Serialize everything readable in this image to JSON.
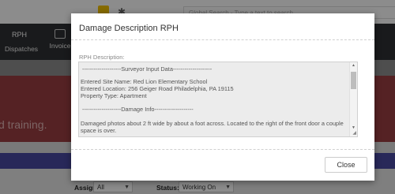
{
  "header": {
    "search_placeholder": "Global Search - Type a text to search"
  },
  "nav": {
    "rph_label": "RPH",
    "dispatches_label": "Dispatches",
    "invoices_label": "Invoice"
  },
  "banner": {
    "text": "d training."
  },
  "filters": {
    "assigned_label": "Assigned To:",
    "assigned_value": "All",
    "status_label": "Status:",
    "status_value": "Working On"
  },
  "modal": {
    "title": "Damage Description RPH",
    "field_label": "RPH Description:",
    "lines": [
      "--------------------Surveyor Input Data--------------------",
      "Entered Site Name: Red Lion Elementary School",
      "Entered Location: 256 Geiger Road Philadelphia, PA 19115",
      "Property Type: Apartment",
      "--------------------Damage Info--------------------",
      "Damaged photos about 2 ft wide by about a foot across. Located to the right of the front door a couple",
      "space is over."
    ],
    "close_label": "Close"
  },
  "colors": {
    "banner": "#9b3e42",
    "navbar": "#2f3133",
    "purple_band": "#4a4aa2",
    "accent_yellow": "#f4c400"
  }
}
